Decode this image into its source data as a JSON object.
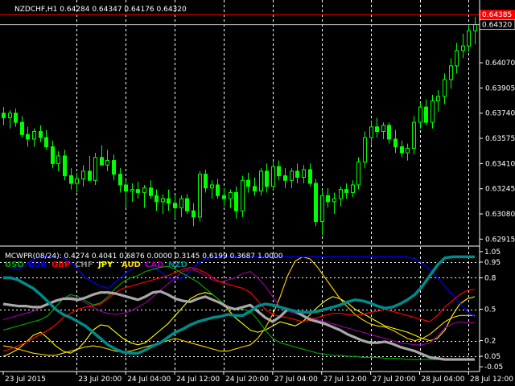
{
  "symbol_info": "NZDCHF,H1  0.64284 0.64347 0.64176 0.64320",
  "main_pane": {
    "price_ticks": [
      "0.64320",
      "0.64070",
      "0.63905",
      "0.63740",
      "0.63575",
      "0.63410",
      "0.63245",
      "0.63080",
      "0.62915"
    ],
    "price_tick_values": [
      0.6432,
      0.6407,
      0.63905,
      0.6374,
      0.63575,
      0.6341,
      0.63245,
      0.6308,
      0.62915
    ],
    "ask_line_label": "0.64385",
    "ask_line_value": 0.64385,
    "bid_line_label": "0.64320",
    "bid_line_value": 0.6432,
    "y_range": [
      0.6288,
      0.6446
    ],
    "candle_color": "#00ff00",
    "candles": [
      [
        0.6374,
        0.6378,
        0.6366,
        0.6371
      ],
      [
        0.6371,
        0.6376,
        0.6364,
        0.6374
      ],
      [
        0.6374,
        0.6377,
        0.6365,
        0.6368
      ],
      [
        0.6368,
        0.6372,
        0.6358,
        0.636
      ],
      [
        0.636,
        0.6365,
        0.6352,
        0.6357
      ],
      [
        0.6357,
        0.6364,
        0.6352,
        0.6362
      ],
      [
        0.6362,
        0.6366,
        0.6355,
        0.6358
      ],
      [
        0.6358,
        0.6363,
        0.635,
        0.6352
      ],
      [
        0.6352,
        0.6356,
        0.6338,
        0.6341
      ],
      [
        0.6341,
        0.6349,
        0.6336,
        0.6346
      ],
      [
        0.6346,
        0.635,
        0.633,
        0.6333
      ],
      [
        0.6333,
        0.6338,
        0.6324,
        0.6328
      ],
      [
        0.6328,
        0.6335,
        0.6322,
        0.6331
      ],
      [
        0.6331,
        0.634,
        0.6326,
        0.6336
      ],
      [
        0.6336,
        0.6346,
        0.633,
        0.633
      ],
      [
        0.633,
        0.6348,
        0.6327,
        0.6345
      ],
      [
        0.6345,
        0.6353,
        0.634,
        0.634
      ],
      [
        0.634,
        0.635,
        0.6336,
        0.6343
      ],
      [
        0.6343,
        0.6347,
        0.633,
        0.6334
      ],
      [
        0.6334,
        0.6338,
        0.6322,
        0.6327
      ],
      [
        0.6327,
        0.633,
        0.6312,
        0.6323
      ],
      [
        0.6323,
        0.6328,
        0.6316,
        0.6324
      ],
      [
        0.6324,
        0.6329,
        0.6318,
        0.6322
      ],
      [
        0.6322,
        0.6327,
        0.6312,
        0.6325
      ],
      [
        0.6325,
        0.633,
        0.6318,
        0.632
      ],
      [
        0.632,
        0.6324,
        0.631,
        0.6316
      ],
      [
        0.6316,
        0.6321,
        0.6308,
        0.6318
      ],
      [
        0.6318,
        0.6324,
        0.631,
        0.6315
      ],
      [
        0.6315,
        0.632,
        0.6305,
        0.6312
      ],
      [
        0.6312,
        0.632,
        0.6306,
        0.6318
      ],
      [
        0.6318,
        0.6321,
        0.6308,
        0.631
      ],
      [
        0.631,
        0.6315,
        0.63,
        0.6306
      ],
      [
        0.6306,
        0.6336,
        0.6303,
        0.6334
      ],
      [
        0.6334,
        0.6337,
        0.6322,
        0.6325
      ],
      [
        0.6325,
        0.633,
        0.6318,
        0.6327
      ],
      [
        0.6327,
        0.6331,
        0.6318,
        0.632
      ],
      [
        0.632,
        0.6325,
        0.6313,
        0.6318
      ],
      [
        0.6318,
        0.6324,
        0.6312,
        0.6322
      ],
      [
        0.6322,
        0.6326,
        0.6305,
        0.631
      ],
      [
        0.631,
        0.6333,
        0.6306,
        0.633
      ],
      [
        0.633,
        0.6335,
        0.6322,
        0.6326
      ],
      [
        0.6326,
        0.6332,
        0.632,
        0.6323
      ],
      [
        0.6323,
        0.6338,
        0.632,
        0.6336
      ],
      [
        0.6336,
        0.6341,
        0.6322,
        0.6326
      ],
      [
        0.6326,
        0.6342,
        0.6324,
        0.6339
      ],
      [
        0.6339,
        0.6343,
        0.633,
        0.6333
      ],
      [
        0.6333,
        0.6338,
        0.6325,
        0.633
      ],
      [
        0.633,
        0.6338,
        0.6325,
        0.6336
      ],
      [
        0.6336,
        0.6341,
        0.6328,
        0.6332
      ],
      [
        0.6332,
        0.634,
        0.6328,
        0.6337
      ],
      [
        0.6337,
        0.6341,
        0.6326,
        0.6328
      ],
      [
        0.6328,
        0.6331,
        0.63,
        0.6303
      ],
      [
        0.6303,
        0.6324,
        0.6294,
        0.632
      ],
      [
        0.632,
        0.6325,
        0.6312,
        0.6316
      ],
      [
        0.6316,
        0.6322,
        0.6308,
        0.6318
      ],
      [
        0.6318,
        0.6326,
        0.6313,
        0.6324
      ],
      [
        0.6324,
        0.6328,
        0.6318,
        0.6322
      ],
      [
        0.6322,
        0.633,
        0.6319,
        0.6327
      ],
      [
        0.6327,
        0.6345,
        0.6324,
        0.6342
      ],
      [
        0.6342,
        0.6362,
        0.6338,
        0.6358
      ],
      [
        0.6358,
        0.6369,
        0.6353,
        0.6365
      ],
      [
        0.6365,
        0.6371,
        0.6358,
        0.6362
      ],
      [
        0.6362,
        0.6368,
        0.6357,
        0.6366
      ],
      [
        0.6366,
        0.6368,
        0.6354,
        0.6357
      ],
      [
        0.6357,
        0.6363,
        0.6348,
        0.6352
      ],
      [
        0.6352,
        0.6356,
        0.6345,
        0.6348
      ],
      [
        0.6348,
        0.6354,
        0.6343,
        0.6351
      ],
      [
        0.6351,
        0.6372,
        0.6347,
        0.6368
      ],
      [
        0.6368,
        0.6381,
        0.6364,
        0.6378
      ],
      [
        0.6378,
        0.6383,
        0.6366,
        0.6368
      ],
      [
        0.6368,
        0.6386,
        0.6364,
        0.6382
      ],
      [
        0.6382,
        0.6389,
        0.6375,
        0.6385
      ],
      [
        0.6385,
        0.64,
        0.638,
        0.6396
      ],
      [
        0.6396,
        0.641,
        0.639,
        0.6405
      ],
      [
        0.6405,
        0.642,
        0.64,
        0.6415
      ],
      [
        0.6415,
        0.6426,
        0.641,
        0.6418
      ],
      [
        0.6418,
        0.6432,
        0.6414,
        0.6428
      ],
      [
        0.6428,
        0.6437,
        0.6419,
        0.6432
      ]
    ]
  },
  "indicator_pane": {
    "title": "MCWPR(08/24): 0.4274 0.4041 0.6876 0.0000 0.3145 0.6199 0.3687 1.0000",
    "level_ticks": [
      "1.05",
      "0.95",
      "0.8",
      "0.5",
      "0.2",
      "0.05",
      "-0.05"
    ],
    "level_tick_values": [
      1.05,
      0.95,
      0.8,
      0.5,
      0.2,
      0.05,
      -0.05
    ],
    "dotted_levels": [
      0.95,
      0.8,
      0.5,
      0.2,
      0.05
    ],
    "y_range": [
      -0.08,
      1.08
    ],
    "currencies": [
      {
        "name": "USD",
        "color": "#00a000"
      },
      {
        "name": "EUR",
        "color": "#0000ff"
      },
      {
        "name": "GBP",
        "color": "#ff0000"
      },
      {
        "name": "CHF",
        "color": "#808080"
      },
      {
        "name": "JPY",
        "color": "#ffff00"
      },
      {
        "name": "AUD",
        "color": "#ffd700"
      },
      {
        "name": "CAD",
        "color": "#a000a0"
      },
      {
        "name": "NZD",
        "color": "#008b8b"
      }
    ],
    "series": [
      {
        "name": "NZD",
        "color": "#008b8b",
        "width": 3.5,
        "values": [
          0.8,
          0.8,
          0.78,
          0.74,
          0.7,
          0.64,
          0.57,
          0.5,
          0.45,
          0.42,
          0.38,
          0.34,
          0.28,
          0.22,
          0.16,
          0.12,
          0.09,
          0.08,
          0.08,
          0.11,
          0.15,
          0.18,
          0.23,
          0.28,
          0.31,
          0.35,
          0.38,
          0.4,
          0.42,
          0.43,
          0.45,
          0.44,
          0.44,
          0.48,
          0.53,
          0.55,
          0.54,
          0.52,
          0.5,
          0.48,
          0.47,
          0.47,
          0.48,
          0.5,
          0.52,
          0.54,
          0.57,
          0.59,
          0.58,
          0.56,
          0.53,
          0.51,
          0.52,
          0.55,
          0.59,
          0.64,
          0.72,
          0.82,
          0.92,
          0.99,
          1.0,
          1.0,
          1.0,
          1.0
        ]
      },
      {
        "name": "CHF",
        "color": "#a8a8a8",
        "width": 3.2,
        "values": [
          0.55,
          0.54,
          0.53,
          0.53,
          0.52,
          0.52,
          0.55,
          0.58,
          0.6,
          0.6,
          0.59,
          0.61,
          0.64,
          0.66,
          0.66,
          0.65,
          0.63,
          0.61,
          0.59,
          0.62,
          0.66,
          0.67,
          0.64,
          0.6,
          0.58,
          0.57,
          0.6,
          0.62,
          0.59,
          0.56,
          0.52,
          0.5,
          0.52,
          0.54,
          0.48,
          0.42,
          0.38,
          0.43,
          0.5,
          0.48,
          0.44,
          0.4,
          0.38,
          0.36,
          0.33,
          0.3,
          0.26,
          0.23,
          0.2,
          0.18,
          0.18,
          0.19,
          0.17,
          0.14,
          0.12,
          0.1,
          0.07,
          0.04,
          0.03,
          0.02,
          0.02,
          0.02,
          0.02,
          0.02
        ]
      },
      {
        "name": "EUR",
        "color": "#0000ff",
        "width": 1.2,
        "values": [
          0.92,
          0.9,
          0.88,
          0.92,
          0.98,
          1.0,
          1.0,
          1.0,
          0.99,
          0.95,
          0.88,
          0.8,
          0.76,
          0.72,
          0.7,
          0.76,
          0.82,
          0.88,
          0.92,
          0.92,
          0.9,
          0.86,
          0.8,
          0.78,
          0.8,
          0.86,
          0.94,
          0.98,
          1.0,
          1.0,
          1.0,
          1.0,
          1.0,
          1.0,
          1.0,
          1.0,
          1.0,
          1.0,
          1.0,
          1.0,
          1.0,
          1.0,
          1.0,
          1.0,
          1.0,
          1.0,
          1.0,
          1.0,
          1.0,
          1.0,
          1.0,
          1.0,
          1.0,
          1.0,
          1.0,
          0.98,
          0.94,
          0.88,
          0.8,
          0.72,
          0.64,
          0.56,
          0.48,
          0.43
        ]
      },
      {
        "name": "GBP",
        "color": "#ff0000",
        "width": 1.2,
        "values": [
          0.1,
          0.12,
          0.15,
          0.18,
          0.22,
          0.26,
          0.3,
          0.35,
          0.42,
          0.46,
          0.5,
          0.52,
          0.53,
          0.55,
          0.6,
          0.66,
          0.7,
          0.72,
          0.74,
          0.76,
          0.78,
          0.8,
          0.82,
          0.85,
          0.88,
          0.9,
          0.88,
          0.85,
          0.8,
          0.76,
          0.74,
          0.72,
          0.7,
          0.66,
          0.58,
          0.5,
          0.45,
          0.43,
          0.42,
          0.4,
          0.38,
          0.4,
          0.42,
          0.44,
          0.46,
          0.46,
          0.45,
          0.44,
          0.45,
          0.47,
          0.48,
          0.5,
          0.48,
          0.46,
          0.44,
          0.42,
          0.4,
          0.38,
          0.44,
          0.52,
          0.58,
          0.64,
          0.68,
          0.69
        ]
      },
      {
        "name": "USD",
        "color": "#00a000",
        "width": 1.2,
        "values": [
          0.3,
          0.32,
          0.34,
          0.36,
          0.38,
          0.4,
          0.44,
          0.52,
          0.6,
          0.64,
          0.62,
          0.58,
          0.54,
          0.56,
          0.62,
          0.7,
          0.76,
          0.8,
          0.82,
          0.86,
          0.88,
          0.9,
          0.91,
          0.88,
          0.84,
          0.8,
          0.76,
          0.7,
          0.64,
          0.58,
          0.52,
          0.5,
          0.5,
          0.48,
          0.4,
          0.3,
          0.22,
          0.18,
          0.16,
          0.14,
          0.12,
          0.1,
          0.08,
          0.07,
          0.06,
          0.06,
          0.05,
          0.05,
          0.04,
          0.04,
          0.04,
          0.03,
          0.03,
          0.03,
          0.02,
          0.02,
          0.02,
          0.02,
          0.02,
          0.02,
          0.02,
          0.02,
          0.02,
          0.02
        ]
      },
      {
        "name": "JPY",
        "color": "#ffff00",
        "width": 1.1,
        "values": [
          0.05,
          0.08,
          0.12,
          0.18,
          0.25,
          0.28,
          0.22,
          0.15,
          0.1,
          0.08,
          0.12,
          0.2,
          0.3,
          0.35,
          0.34,
          0.28,
          0.22,
          0.18,
          0.16,
          0.18,
          0.24,
          0.3,
          0.36,
          0.44,
          0.52,
          0.6,
          0.64,
          0.66,
          0.64,
          0.58,
          0.5,
          0.42,
          0.36,
          0.3,
          0.28,
          0.3,
          0.34,
          0.38,
          0.36,
          0.34,
          0.38,
          0.45,
          0.52,
          0.58,
          0.62,
          0.6,
          0.56,
          0.5,
          0.46,
          0.42,
          0.38,
          0.34,
          0.32,
          0.3,
          0.28,
          0.25,
          0.22,
          0.2,
          0.22,
          0.3,
          0.44,
          0.55,
          0.6,
          0.62
        ]
      },
      {
        "name": "AUD",
        "color": "#ffd700",
        "width": 1.1,
        "values": [
          0.15,
          0.14,
          0.12,
          0.1,
          0.08,
          0.07,
          0.06,
          0.06,
          0.08,
          0.1,
          0.12,
          0.14,
          0.15,
          0.14,
          0.12,
          0.1,
          0.09,
          0.1,
          0.12,
          0.14,
          0.16,
          0.18,
          0.2,
          0.22,
          0.2,
          0.18,
          0.16,
          0.14,
          0.12,
          0.1,
          0.1,
          0.12,
          0.14,
          0.16,
          0.22,
          0.32,
          0.45,
          0.62,
          0.82,
          0.96,
          1.0,
          0.98,
          0.9,
          0.8,
          0.7,
          0.6,
          0.52,
          0.45,
          0.4,
          0.36,
          0.34,
          0.33,
          0.3,
          0.26,
          0.22,
          0.2,
          0.22,
          0.26,
          0.32,
          0.38,
          0.42,
          0.44,
          0.44,
          0.44
        ]
      },
      {
        "name": "CAD",
        "color": "#a000a0",
        "width": 1.1,
        "values": [
          0.4,
          0.42,
          0.44,
          0.46,
          0.48,
          0.52,
          0.56,
          0.58,
          0.6,
          0.62,
          0.6,
          0.56,
          0.52,
          0.48,
          0.46,
          0.45,
          0.46,
          0.48,
          0.52,
          0.56,
          0.62,
          0.68,
          0.74,
          0.8,
          0.86,
          0.88,
          0.86,
          0.82,
          0.78,
          0.76,
          0.78,
          0.8,
          0.84,
          0.86,
          0.8,
          0.72,
          0.62,
          0.52,
          0.48,
          0.46,
          0.44,
          0.42,
          0.4,
          0.38,
          0.36,
          0.34,
          0.32,
          0.3,
          0.28,
          0.26,
          0.24,
          0.22,
          0.2,
          0.18,
          0.17,
          0.16,
          0.16,
          0.18,
          0.24,
          0.32,
          0.36,
          0.38,
          0.37,
          0.37
        ]
      }
    ]
  },
  "time_axis": {
    "labels": [
      "23 Jul 2015",
      "23 Jul 20:00",
      "24 Jul 04:00",
      "24 Jul 12:00",
      "24 Jul 20:00",
      "27 Jul 04:00",
      "27 Jul 12:00",
      "27 Jul 20:00",
      "28 Jul 04:00",
      "28 Jul 12:00"
    ],
    "label_bar_positions": [
      0,
      12,
      20,
      28,
      36,
      44,
      52,
      60,
      68,
      76
    ]
  },
  "colors": {
    "background": "#000000",
    "grid": "#ffffff",
    "text": "#ffffff",
    "ask_line": "#ff0000",
    "bid_line": "#c0c0c0"
  }
}
